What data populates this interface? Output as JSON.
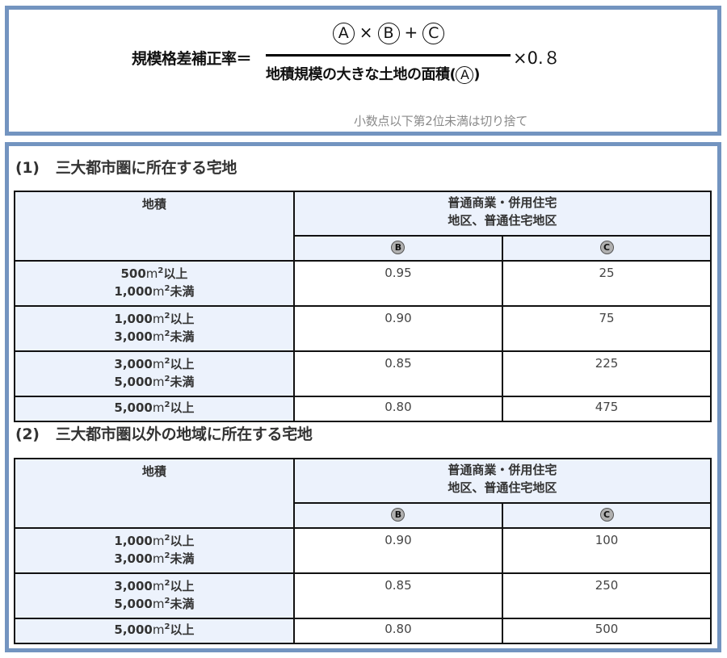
{
  "formula": {
    "label": "規模格差補正率＝",
    "numerator": {
      "a": "A",
      "times": "×",
      "b": "B",
      "plus": "+",
      "c": "C"
    },
    "denominator_text": "地積規模の大きな土地の面積(",
    "denominator_symbol": "A",
    "denominator_close": ")",
    "multiplier": "×0.８",
    "note": "小数点以下第2位未満は切り捨て"
  },
  "sections": [
    {
      "number": "(1)",
      "title": "三大都市圏に所在する宅地",
      "table": {
        "header_area": "地積",
        "header_zone_line1": "普通商業・併用住宅",
        "header_zone_line2": "地区、普通住宅地区",
        "header_b": "B",
        "header_c": "C",
        "rows": [
          {
            "from": "500",
            "to": "1,000",
            "b": "0.95",
            "c": "25"
          },
          {
            "from": "1,000",
            "to": "3,000",
            "b": "0.90",
            "c": "75"
          },
          {
            "from": "3,000",
            "to": "5,000",
            "b": "0.85",
            "c": "225"
          },
          {
            "from": "5,000",
            "to": null,
            "b": "0.80",
            "c": "475"
          }
        ]
      }
    },
    {
      "number": "(2)",
      "title": "三大都市圏以外の地域に所在する宅地",
      "table": {
        "header_area": "地積",
        "header_zone_line1": "普通商業・併用住宅",
        "header_zone_line2": "地区、普通住宅地区",
        "header_b": "B",
        "header_c": "C",
        "rows": [
          {
            "from": "1,000",
            "to": "3,000",
            "b": "0.90",
            "c": "100"
          },
          {
            "from": "3,000",
            "to": "5,000",
            "b": "0.85",
            "c": "250"
          },
          {
            "from": "5,000",
            "to": null,
            "b": "0.80",
            "c": "500"
          }
        ]
      }
    }
  ],
  "units": {
    "area": "m",
    "sup": "2",
    "above": "以上",
    "below": "未満"
  },
  "colors": {
    "frame": "#7394c0",
    "header_bg": "#ecf2fc",
    "note": "#8a8a8a"
  }
}
